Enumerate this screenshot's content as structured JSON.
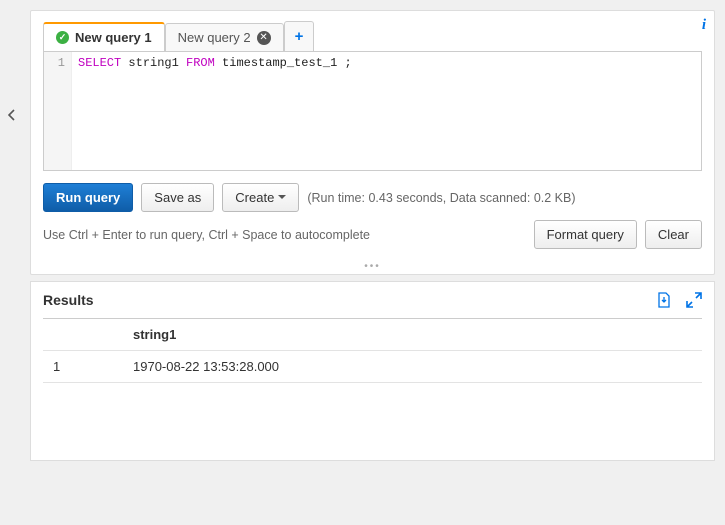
{
  "tabs": [
    {
      "label": "New query 1",
      "status": "success",
      "active": true
    },
    {
      "label": "New query 2",
      "status": "idle",
      "active": false
    }
  ],
  "editor": {
    "line_number": "1",
    "kw_select": "SELECT",
    "col": " string1 ",
    "kw_from": "FROM",
    "rest": " timestamp_test_1 ;"
  },
  "buttons": {
    "run": "Run query",
    "save_as": "Save as",
    "create": "Create",
    "format": "Format query",
    "clear": "Clear"
  },
  "run_info": "(Run time: 0.43 seconds, Data scanned: 0.2 KB)",
  "hint": "Use Ctrl + Enter to run query, Ctrl + Space to autocomplete",
  "results": {
    "title": "Results",
    "columns": [
      "",
      "string1"
    ],
    "rows": [
      {
        "n": "1",
        "string1": "1970-08-22 13:53:28.000"
      }
    ]
  }
}
